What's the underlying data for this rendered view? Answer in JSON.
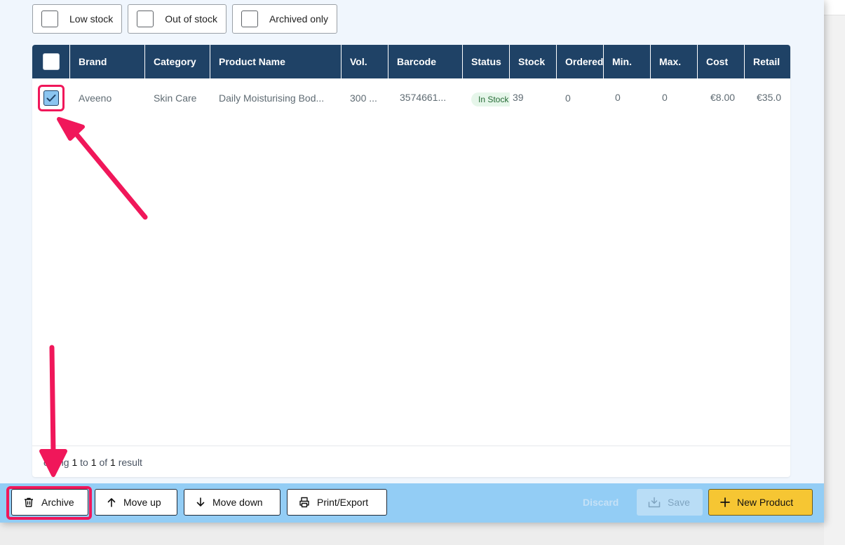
{
  "filters": [
    {
      "label": "Low stock"
    },
    {
      "label": "Out of stock"
    },
    {
      "label": "Archived only"
    }
  ],
  "table": {
    "columns": [
      "Brand",
      "Category",
      "Product Name",
      "Vol.",
      "Barcode",
      "Status",
      "Stock",
      "Ordered",
      "Min.",
      "Max.",
      "Cost",
      "Retail"
    ],
    "rows": [
      {
        "brand": "Aveeno",
        "category": "Skin Care",
        "product_name": "Daily Moisturising Bod...",
        "vol": "300 ...",
        "barcode": "3574661...",
        "status": "In Stock",
        "stock": "39",
        "ordered": "0",
        "min": "0",
        "max": "0",
        "cost": "€8.00",
        "retail": "€35.0"
      }
    ],
    "footer": {
      "prefix": "owing",
      "from": "1",
      "to_word": "to",
      "to": "1",
      "of_word": "of",
      "total": "1",
      "suffix": "result"
    }
  },
  "actions": {
    "archive": "Archive",
    "move_up": "Move up",
    "move_down": "Move down",
    "print_export": "Print/Export",
    "discard": "Discard",
    "save": "Save",
    "new_product": "New Product"
  },
  "icons": {
    "archive": "trash-icon",
    "move_up": "arrow-up-icon",
    "move_down": "arrow-down-icon",
    "print": "printer-icon",
    "save": "save-tray-icon",
    "new": "plus-icon"
  },
  "colors": {
    "header": "#1f4266",
    "highlight": "#f0175a",
    "action_bar": "#93cdf5",
    "primary": "#f6c633",
    "in_stock_badge": "#e6f6ea"
  }
}
